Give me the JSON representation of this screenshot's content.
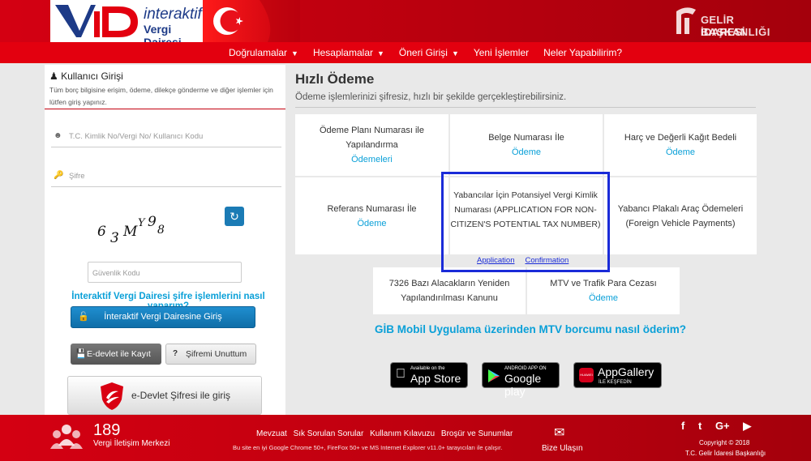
{
  "header": {
    "logo_letters": "iVD",
    "logo_line1": "interaktif",
    "logo_line2": "Vergi Dairesi",
    "gib_line1": "GELİR İDARESİ",
    "gib_line2": "BAŞKANLIĞI"
  },
  "nav": {
    "items": [
      {
        "label": "Doğrulamalar",
        "caret": "▼"
      },
      {
        "label": "Hesaplamalar",
        "caret": "▼"
      },
      {
        "label": "Öneri Girişi",
        "caret": "▼"
      },
      {
        "label": "Yeni İşlemler",
        "caret": ""
      },
      {
        "label": "Neler Yapabilirim?",
        "caret": ""
      }
    ]
  },
  "login": {
    "title": "Kullanıcı Girişi",
    "subtitle": "Tüm borç bilgisine erişim, ödeme, dilekçe gönderme ve diğer işlemler için lütfen giriş yapınız.",
    "user_placeholder": "T.C. Kimlik No/Vergi No/ Kullanıcı Kodu",
    "password_placeholder": "Şifre",
    "captcha": [
      "6",
      "3",
      "M",
      "Y",
      "9",
      "8"
    ],
    "security_placeholder": "Güvenlik Kodu",
    "help_link": "İnteraktif Vergi Dairesi şifre işlemlerini nasıl yaparım?",
    "login_button": "İnteraktif Vergi Dairesine Giriş",
    "edevlet_register": "E-devlet ile Kayıt Ol",
    "forgot_password": "Şifremi Unuttum",
    "edevlet_login": "e-Devlet Şifresi ile giriş"
  },
  "quick_pay": {
    "title": "Hızlı Ödeme",
    "subtitle": "Ödeme işlemlerinizi şifresiz, hızlı bir şekilde gerçekleştirebilirsiniz.",
    "cards": [
      {
        "text": "Ödeme Planı Numarası ile Yapılandırma",
        "link": "Ödemeleri"
      },
      {
        "text": "Belge Numarası İle",
        "link": "Ödeme"
      },
      {
        "text": "Harç ve Değerli Kağıt Bedeli",
        "link": "Ödeme"
      },
      {
        "text": "Referans Numarası İle",
        "link": "Ödeme"
      },
      {
        "text": "Yabancı Plakalı Araç Ödemeleri (Foreign Vehicle Payments)",
        "link": ""
      },
      {
        "text": "7326 Bazı Alacakların Yeniden Yapılandırılması Kanunu",
        "link": ""
      },
      {
        "text": "MTV ve Trafik Para Cezası",
        "link": "Ödeme"
      }
    ],
    "focus_card": {
      "text": "Yabancılar İçin Potansiyel Vergi Kimlik Numarası (APPLICATION FOR NON-CITIZEN'S POTENTIAL TAX NUMBER)",
      "link1": "Application",
      "link2": "Confirmation"
    },
    "mobile_link": "GİB Mobil Uygulama üzerinden MTV borcumu nasıl öderim?"
  },
  "stores": {
    "apple_small": "Available on the",
    "apple_big": "App Store",
    "google_small": "ANDROID APP ON",
    "google_big": "Google play",
    "huawei_big": "AppGallery",
    "huawei_small": "İLE KEŞFEDİN",
    "huawei_badge": "HUAWEI"
  },
  "footer": {
    "phone": "189",
    "phone_label": "Vergi İletişim Merkezi",
    "links": [
      "Mevzuat",
      "Sık Sorulan Sorular",
      "Kullanım Kılavuzu",
      "Broşür ve Sunumlar"
    ],
    "note": "Bu site en iyi Google Chrome 50+, FireFox 50+ ve MS Internet Explorer v11.0+ tarayıcıları ile çalışır.",
    "contact": "Bize Ulaşın",
    "social": [
      "f",
      "t",
      "G+",
      "▶"
    ],
    "copyright": "Copyright © 2018",
    "org": "T.C. Gelir İdaresi Başkanlığı"
  },
  "colors": {
    "brand_red": "#e3000f",
    "link_blue": "#0aa0d8",
    "button_blue": "#1b7bb5",
    "focus_blue": "#1a2bd8"
  }
}
